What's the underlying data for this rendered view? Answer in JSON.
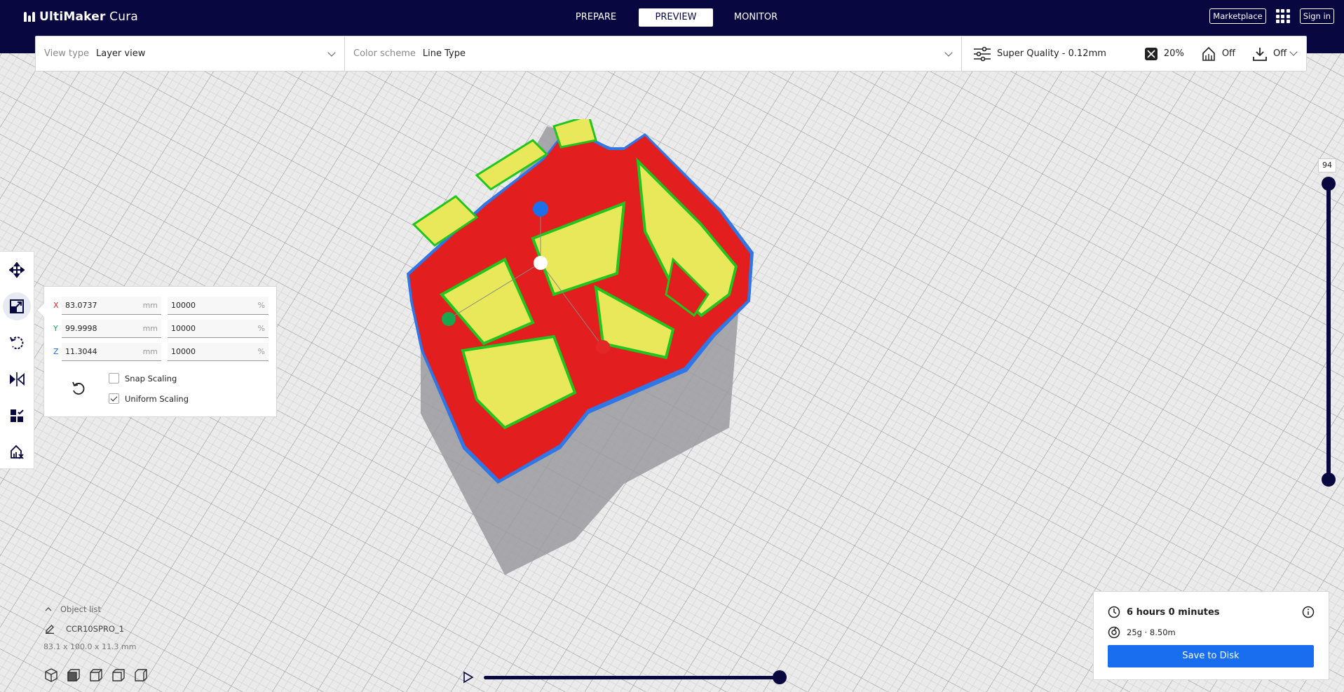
{
  "app": {
    "brand_bold": "UltiMaker",
    "brand_rest": " Cura"
  },
  "stages": [
    {
      "label": "PREPARE",
      "active": false
    },
    {
      "label": "PREVIEW",
      "active": true
    },
    {
      "label": "MONITOR",
      "active": false
    }
  ],
  "header": {
    "marketplace_label": "Marketplace",
    "signin_label": "Sign in",
    "apps_icon": "apps-grid-icon"
  },
  "view_type": {
    "label": "View type",
    "value": "Layer view"
  },
  "color_scheme": {
    "label": "Color scheme",
    "value": "Line Type"
  },
  "print_settings": {
    "profile": "Super Quality - 0.12mm",
    "infill": "20%",
    "support": "Off",
    "adhesion": "Off"
  },
  "left_tools": [
    {
      "name": "move-tool",
      "icon": "move-icon",
      "active": false
    },
    {
      "name": "scale-tool",
      "icon": "scale-icon",
      "active": true
    },
    {
      "name": "rotate-tool",
      "icon": "rotate-icon",
      "active": false
    },
    {
      "name": "mirror-tool",
      "icon": "mirror-icon",
      "active": false
    },
    {
      "name": "per-model-settings-tool",
      "icon": "per-model-settings-icon",
      "active": false
    },
    {
      "name": "support-blocker-tool",
      "icon": "support-blocker-icon",
      "active": false
    }
  ],
  "scale_panel": {
    "rows": [
      {
        "axis": "X",
        "axis_color": "#e32626",
        "mm": "83.0737",
        "mm_unit": "mm",
        "percent": "10000",
        "percent_unit": "%"
      },
      {
        "axis": "Y",
        "axis_color": "#1aa64c",
        "mm": "99.9998",
        "mm_unit": "mm",
        "percent": "10000",
        "percent_unit": "%"
      },
      {
        "axis": "Z",
        "axis_color": "#1c6fe8",
        "mm": "11.3044",
        "mm_unit": "mm",
        "percent": "10000",
        "percent_unit": "%"
      }
    ],
    "snap_scaling": {
      "label": "Snap Scaling",
      "checked": false
    },
    "uniform_scaling": {
      "label": "Uniform Scaling",
      "checked": true
    }
  },
  "layer_slider": {
    "current_layer": "94",
    "color": "#08073f"
  },
  "object_list": {
    "title": "Object list",
    "object_name": "CCR10SPRO_1",
    "dimensions": "83.1 x 100.0 x 11.3 mm"
  },
  "print_summary": {
    "time": "6 hours 0 minutes",
    "material": "25g · 8.50m",
    "save_label": "Save to Disk"
  },
  "colors": {
    "header_bg": "#08073f",
    "accent_blue": "#196ef0",
    "wall_red": "#e31e1e",
    "infill_yellow": "#e8e85a",
    "inner_wall_green": "#22c41e"
  }
}
